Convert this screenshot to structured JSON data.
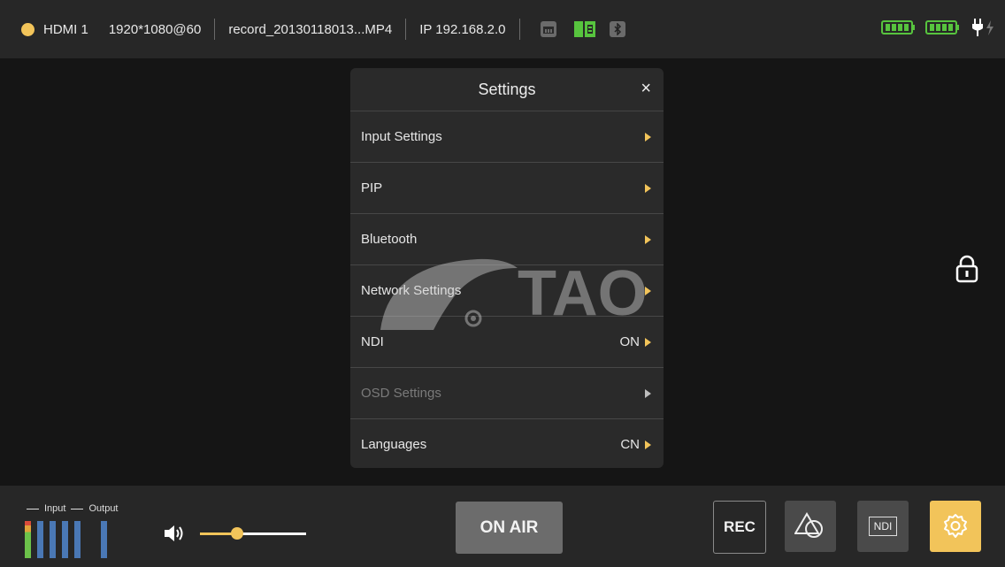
{
  "status_bar": {
    "source": "HDMI 1",
    "resolution": "1920*1080@60",
    "file": "record_20130118013...MP4",
    "ip": "IP 192.168.2.0",
    "icons": [
      "record-indicator-icon",
      "ethernet-icon",
      "sd-card-icon",
      "bluetooth-icon",
      "battery-icon",
      "battery-icon",
      "power-adapter-icon"
    ],
    "colors": {
      "accent": "#f2c45a",
      "sd_card": "#57c43e",
      "battery": "#57c43e"
    }
  },
  "dialog": {
    "title": "Settings",
    "close_label": "×",
    "items": [
      {
        "label": "Input Settings",
        "value": ""
      },
      {
        "label": "PIP",
        "value": ""
      },
      {
        "label": "Bluetooth",
        "value": ""
      },
      {
        "label": "Network Settings",
        "value": ""
      },
      {
        "label": "NDI",
        "value": "ON"
      },
      {
        "label": "OSD Settings",
        "value": ""
      },
      {
        "label": "Languages",
        "value": "CN"
      }
    ]
  },
  "watermark": {
    "text": "TAO"
  },
  "bottom_bar": {
    "meter_input_label": "Input",
    "meter_output_label": "Output",
    "volume_level": 0.35,
    "on_air_label": "ON AIR",
    "rec_label": "REC",
    "ndi_label": "NDI"
  }
}
